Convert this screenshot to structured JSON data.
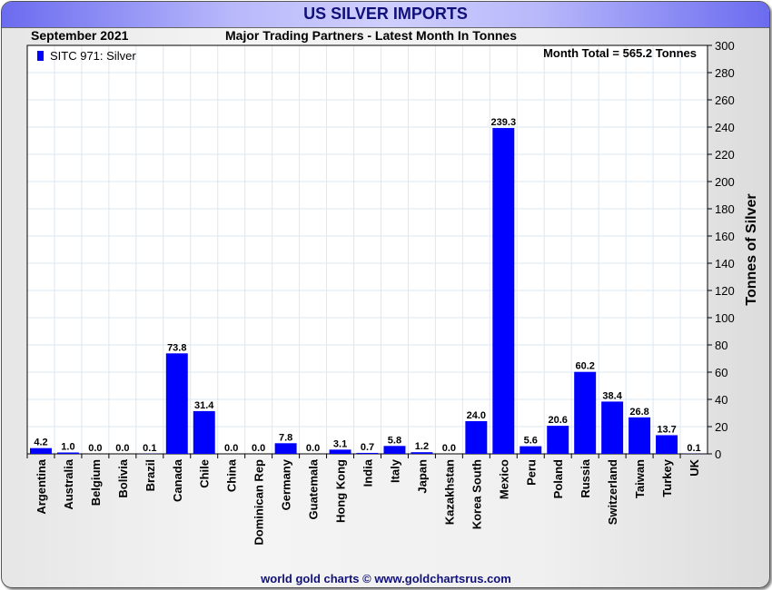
{
  "header": {
    "title": "US SILVER IMPORTS",
    "date": "September 2021",
    "subtitle": "Major Trading Partners - Latest Month In Tonnes",
    "footer": "world gold charts © www.goldchartsrus.com"
  },
  "chart_data": {
    "type": "bar",
    "title": "US SILVER IMPORTS",
    "subtitle": "Major Trading Partners - Latest Month In Tonnes",
    "xlabel": "",
    "ylabel": "Tonnes of Silver",
    "ylim": [
      0,
      300
    ],
    "yticks": [
      0,
      20,
      40,
      60,
      80,
      100,
      120,
      140,
      160,
      180,
      200,
      220,
      240,
      260,
      280,
      300
    ],
    "y_axis_position": "right",
    "grid": true,
    "legend": {
      "label": "SITC 971: Silver",
      "placement": "top-left",
      "color": "#0000ff"
    },
    "annotation": "Month Total = 565.2 Tonnes",
    "categories": [
      "Argentina",
      "Australia",
      "Belgium",
      "Bolivia",
      "Brazil",
      "Canada",
      "Chile",
      "China",
      "Dominican Rep",
      "Germany",
      "Guatemala",
      "Hong Kong",
      "India",
      "Italy",
      "Japan",
      "Kazakhstan",
      "Korea South",
      "Mexico",
      "Peru",
      "Poland",
      "Russia",
      "Switzerland",
      "Taiwan",
      "Turkey",
      "UK"
    ],
    "values": [
      4.2,
      1.0,
      0.0,
      0.0,
      0.1,
      73.8,
      31.4,
      0.0,
      0.0,
      7.8,
      0.0,
      3.1,
      0.7,
      5.8,
      1.2,
      0.0,
      24.0,
      239.3,
      5.6,
      20.6,
      60.2,
      38.4,
      26.8,
      13.7,
      0.1
    ],
    "labels": [
      "4.2",
      "1.0",
      "0.0",
      "0.0",
      "0.1",
      "73.8",
      "31.4",
      "0.0",
      "0.0",
      "7.8",
      "0.0",
      "3.1",
      "0.7",
      "5.8",
      "1.2",
      "0.0",
      "24.0",
      "239.3",
      "5.6",
      "20.6",
      "60.2",
      "38.4",
      "26.8",
      "13.7",
      "0.1"
    ],
    "bar_color": "#0000ff"
  }
}
